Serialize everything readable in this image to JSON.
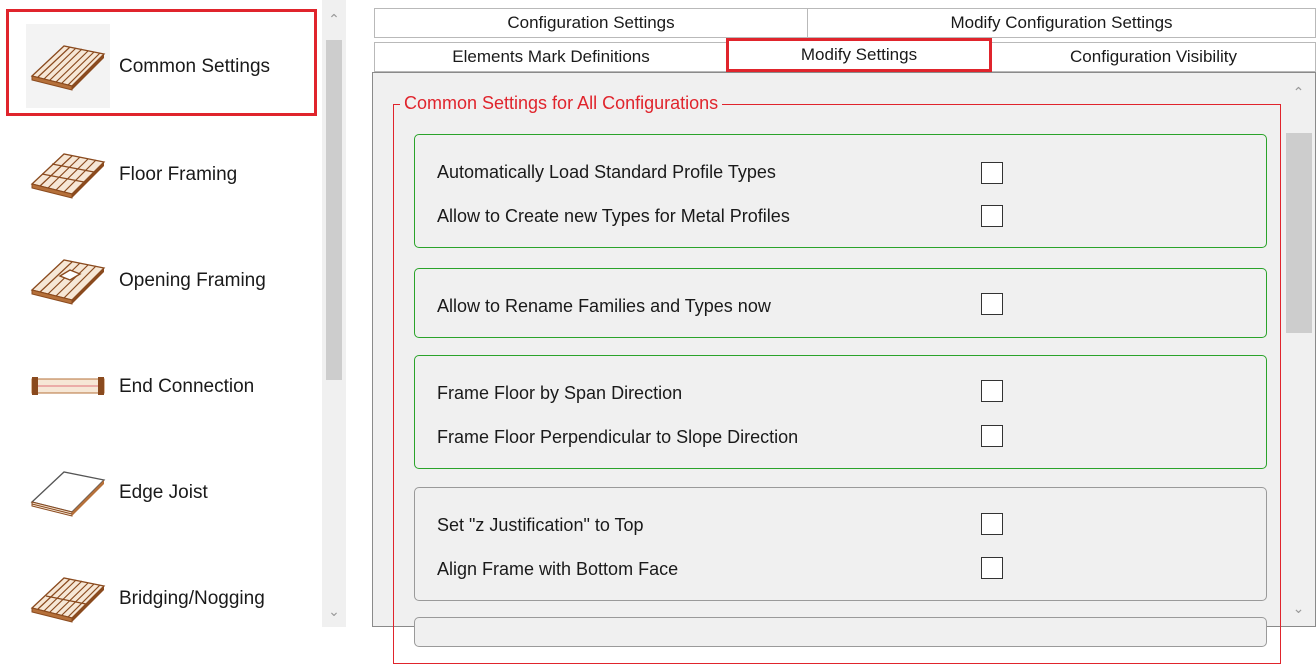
{
  "sidebar": {
    "items": [
      {
        "label": "Common Settings",
        "icon": "parallel-boards-icon",
        "active": true
      },
      {
        "label": "Floor Framing",
        "icon": "floor-framing-icon"
      },
      {
        "label": "Opening Framing",
        "icon": "opening-framing-icon"
      },
      {
        "label": "End Connection",
        "icon": "end-connection-icon"
      },
      {
        "label": "Edge Joist",
        "icon": "edge-joist-icon"
      },
      {
        "label": "Bridging/Nogging",
        "icon": "bridging-nogging-icon"
      }
    ]
  },
  "tabs": {
    "row1": [
      "Configuration Settings",
      "Modify Configuration Settings"
    ],
    "row2": [
      "Elements Mark Definitions",
      "Modify Settings",
      "Configuration Visibility"
    ],
    "selected": "Modify Settings"
  },
  "groupbox": {
    "title": "Common Settings for All Configurations",
    "groups": [
      {
        "options": [
          {
            "label": "Automatically Load Standard Profile Types",
            "checked": false
          },
          {
            "label": "Allow to Create new Types for Metal Profiles",
            "checked": false
          }
        ]
      },
      {
        "options": [
          {
            "label": "Allow to Rename Families and Types now",
            "checked": false
          }
        ]
      },
      {
        "options": [
          {
            "label": "Frame Floor by Span Direction",
            "checked": false
          },
          {
            "label": "Frame Floor Perpendicular to Slope Direction",
            "checked": false
          }
        ]
      },
      {
        "options": [
          {
            "label": "Set  \"z Justification\" to Top",
            "checked": false
          },
          {
            "label": "Align Frame with Bottom Face",
            "checked": false
          }
        ]
      }
    ]
  },
  "colors": {
    "highlight": "#e0242c",
    "group_border": "#2aa32a",
    "wood": "#b5703a"
  }
}
